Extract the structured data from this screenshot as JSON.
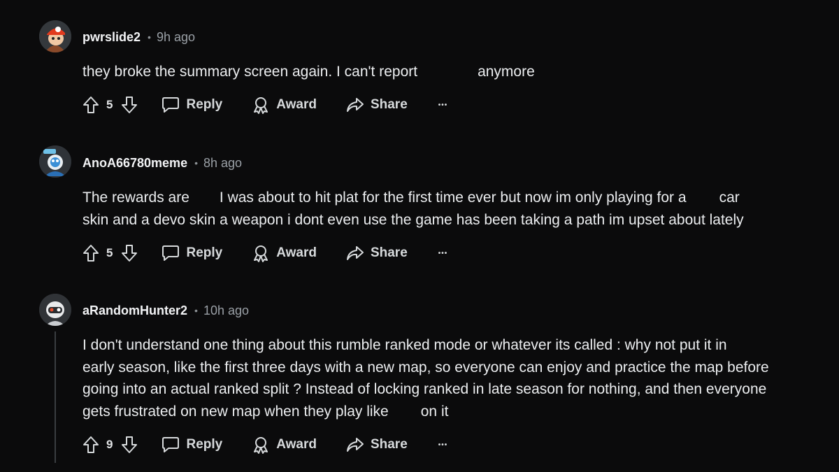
{
  "comments": [
    {
      "username": "pwrslide2",
      "time": "9h ago",
      "text": [
        "they broke the summary screen again. I can't report",
        "anymore"
      ],
      "score": "5"
    },
    {
      "username": "AnoA66780meme",
      "time": "8h ago",
      "line1": [
        "The rewards are",
        "I was about to hit plat for the first time ever but now im only playing for a",
        "car"
      ],
      "line2": "skin and a devo skin a weapon i dont even use the game has been taking a path im upset about lately",
      "score": "5"
    },
    {
      "username": "aRandomHunter2",
      "time": "10h ago",
      "lines": [
        "I don't understand one thing about this rumble ranked mode or whatever its called : why not put it in",
        "early season, like the first three days with a new map, so everyone can enjoy and practice the map before",
        "going into an actual ranked split ? Instead of locking ranked in late season for nothing, and then everyone"
      ],
      "line4": [
        "gets frustrated on new map when they play like",
        "on it"
      ],
      "score": "9"
    }
  ],
  "actions": {
    "reply": "Reply",
    "award": "Award",
    "share": "Share",
    "more": "•••"
  },
  "separator": "•",
  "icons": {
    "upvote": "upvote-arrow-icon",
    "downvote": "downvote-arrow-icon",
    "reply": "speech-bubble-icon",
    "award": "award-ribbon-icon",
    "share": "share-arrow-icon",
    "more": "more-options-icon"
  }
}
